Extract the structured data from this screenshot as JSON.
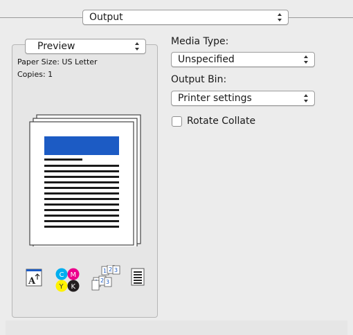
{
  "output_menu": {
    "selected": "Output"
  },
  "preview_panel": {
    "menu_selected": "Preview",
    "paper_size": "Paper Size: US Letter",
    "copies": "Copies: 1",
    "icons": [
      "text-orientation-icon",
      "cmyk-color-icon",
      "multiple-pages-icon",
      "document-layout-icon"
    ]
  },
  "media_type": {
    "label": "Media Type:",
    "selected": "Unspecified"
  },
  "output_bin": {
    "label": "Output Bin:",
    "selected": "Printer settings"
  },
  "rotate_collate": {
    "label": "Rotate Collate",
    "checked": false
  },
  "colors": {
    "accent_blue": "#1c5bc4",
    "cmyk_cyan": "#00aeef",
    "cmyk_magenta": "#ec008c",
    "cmyk_yellow": "#fff200",
    "cmyk_black": "#231f20"
  }
}
